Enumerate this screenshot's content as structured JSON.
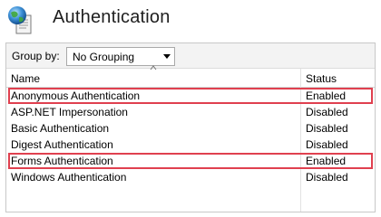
{
  "header": {
    "title": "Authentication",
    "icon": "iis-globe-document-icon"
  },
  "toolbar": {
    "group_label": "Group by:",
    "group_value": "No Grouping"
  },
  "table": {
    "columns": [
      "Name",
      "Status"
    ],
    "rows": [
      {
        "name": "Anonymous Authentication",
        "status": "Enabled",
        "highlighted": true
      },
      {
        "name": "ASP.NET Impersonation",
        "status": "Disabled",
        "highlighted": false
      },
      {
        "name": "Basic Authentication",
        "status": "Disabled",
        "highlighted": false
      },
      {
        "name": "Digest Authentication",
        "status": "Disabled",
        "highlighted": false
      },
      {
        "name": "Forms Authentication",
        "status": "Enabled",
        "highlighted": true
      },
      {
        "name": "Windows Authentication",
        "status": "Disabled",
        "highlighted": false
      }
    ]
  },
  "colors": {
    "highlight": "#e0404f"
  }
}
